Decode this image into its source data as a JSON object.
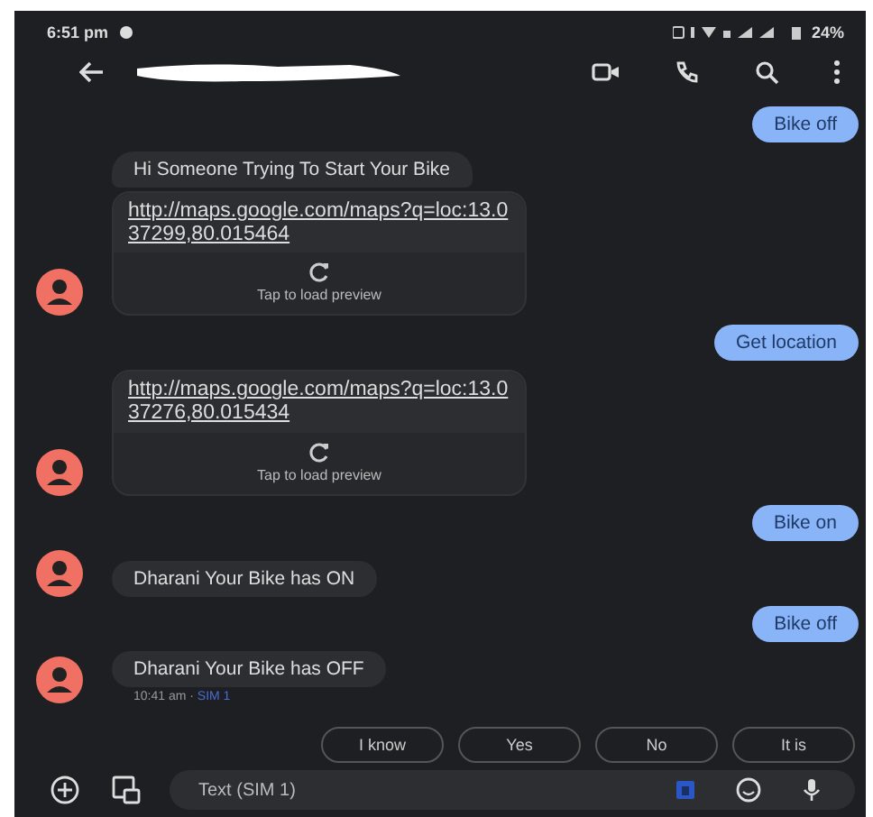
{
  "status_bar": {
    "time": "6:51 pm",
    "battery": "24%"
  },
  "header": {
    "name_redacted": true
  },
  "messages": [
    {
      "kind": "outgoing",
      "text": "Bike off"
    },
    {
      "kind": "incoming_link",
      "text": "Hi  Someone Trying To Start Your Bike",
      "link": "http://maps.google.com/maps?q=loc:13.037299,80.015464",
      "preview": "Tap to load preview"
    },
    {
      "kind": "outgoing",
      "text": "Get location"
    },
    {
      "kind": "incoming_link",
      "link": "http://maps.google.com/maps?q=loc:13.037276,80.015434",
      "preview": "Tap to load preview"
    },
    {
      "kind": "outgoing",
      "text": "Bike on"
    },
    {
      "kind": "incoming",
      "text": "Dharani Your Bike has ON"
    },
    {
      "kind": "outgoing",
      "text": "Bike off"
    },
    {
      "kind": "incoming",
      "text": "Dharani Your Bike has OFF",
      "time": "10:41 am",
      "separator": "·",
      "sim": "SIM 1"
    }
  ],
  "smart_replies": [
    "I know",
    "Yes",
    "No",
    "It is"
  ],
  "compose": {
    "placeholder": "Text (SIM 1)"
  }
}
